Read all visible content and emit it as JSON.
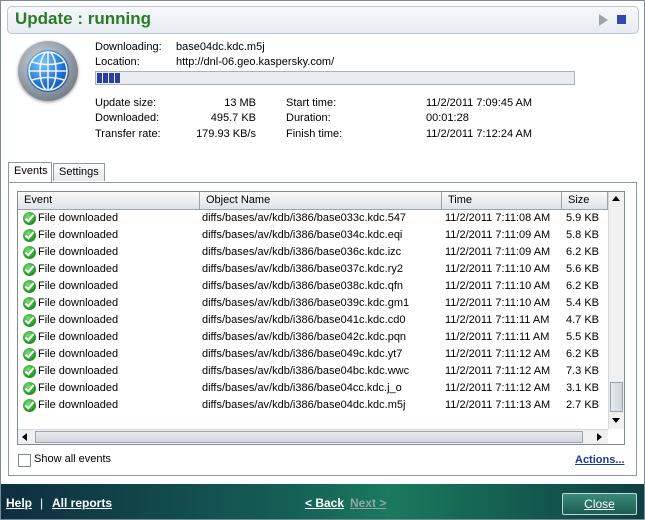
{
  "window": {
    "title": "Update : running"
  },
  "download": {
    "downloading_label": "Downloading:",
    "downloading_value": "base04dc.kdc.m5j",
    "location_label": "Location:",
    "location_value": "http://dnl-06.geo.kaspersky.com/",
    "progress": 0.05
  },
  "stats": {
    "update_size_label": "Update size:",
    "update_size_value": "13 MB",
    "downloaded_label": "Downloaded:",
    "downloaded_value": "495.7 KB",
    "transfer_rate_label": "Transfer rate:",
    "transfer_rate_value": "179.93 KB/s",
    "start_time_label": "Start time:",
    "start_time_value": "11/2/2011 7:09:45 AM",
    "duration_label": "Duration:",
    "duration_value": "00:01:28",
    "finish_time_label": "Finish time:",
    "finish_time_value": "11/2/2011 7:12:24 AM"
  },
  "tabs": [
    "Events",
    "Settings"
  ],
  "table": {
    "columns": [
      "Event",
      "Object Name",
      "Time",
      "Size"
    ],
    "rows": [
      [
        "File downloaded",
        "diffs/bases/av/kdb/i386/base033c.kdc.547",
        "11/2/2011 7:11:08 AM",
        "5.9 KB"
      ],
      [
        "File downloaded",
        "diffs/bases/av/kdb/i386/base034c.kdc.eqi",
        "11/2/2011 7:11:09 AM",
        "5.8 KB"
      ],
      [
        "File downloaded",
        "diffs/bases/av/kdb/i386/base036c.kdc.izc",
        "11/2/2011 7:11:09 AM",
        "6.2 KB"
      ],
      [
        "File downloaded",
        "diffs/bases/av/kdb/i386/base037c.kdc.ry2",
        "11/2/2011 7:11:10 AM",
        "5.6 KB"
      ],
      [
        "File downloaded",
        "diffs/bases/av/kdb/i386/base038c.kdc.qfn",
        "11/2/2011 7:11:10 AM",
        "6.2 KB"
      ],
      [
        "File downloaded",
        "diffs/bases/av/kdb/i386/base039c.kdc.gm1",
        "11/2/2011 7:11:10 AM",
        "5.4 KB"
      ],
      [
        "File downloaded",
        "diffs/bases/av/kdb/i386/base041c.kdc.cd0",
        "11/2/2011 7:11:11 AM",
        "4.7 KB"
      ],
      [
        "File downloaded",
        "diffs/bases/av/kdb/i386/base042c.kdc.pqn",
        "11/2/2011 7:11:11 AM",
        "5.5 KB"
      ],
      [
        "File downloaded",
        "diffs/bases/av/kdb/i386/base049c.kdc.yt7",
        "11/2/2011 7:11:12 AM",
        "6.2 KB"
      ],
      [
        "File downloaded",
        "diffs/bases/av/kdb/i386/base04bc.kdc.wwc",
        "11/2/2011 7:11:12 AM",
        "7.3 KB"
      ],
      [
        "File downloaded",
        "diffs/bases/av/kdb/i386/base04cc.kdc.j_o",
        "11/2/2011 7:11:12 AM",
        "3.1 KB"
      ],
      [
        "File downloaded",
        "diffs/bases/av/kdb/i386/base04dc.kdc.m5j",
        "11/2/2011 7:11:13 AM",
        "2.7 KB"
      ]
    ]
  },
  "options": {
    "show_all_events": "Show all events",
    "actions": "Actions..."
  },
  "footer": {
    "help": "Help",
    "separator": "|",
    "all_reports": "All reports",
    "back": "< Back",
    "next": "Next >",
    "close": "Close"
  }
}
